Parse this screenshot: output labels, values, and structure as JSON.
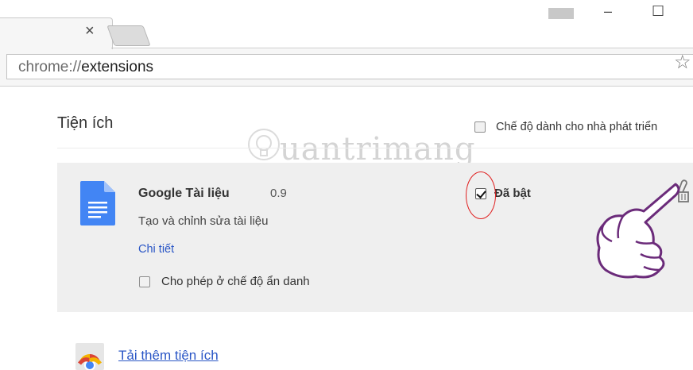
{
  "browser": {
    "tab_close_glyph": "×",
    "window_minimize_glyph": "–",
    "window_maximize_glyph": "☐",
    "url_scheme": "chrome://",
    "url_path": "extensions",
    "star_glyph": "☆"
  },
  "page": {
    "title": "Tiện ích",
    "developer_mode_label": "Chế độ dành cho nhà phát triển",
    "developer_mode_checked": false
  },
  "extension": {
    "name": "Google Tài liệu",
    "version": "0.9",
    "description": "Tạo và chỉnh sửa tài liệu",
    "details_link": "Chi tiết",
    "incognito_label": "Cho phép ở chế độ ẩn danh",
    "incognito_checked": false,
    "enabled_label": "Đã bật",
    "enabled_checked": true,
    "icon": "google-docs-icon"
  },
  "footer": {
    "get_more_link": "Tải thêm tiện ích"
  },
  "watermark": {
    "text": "uantrimang"
  },
  "colors": {
    "link": "#2a56c6",
    "docs_blue": "#4285f4",
    "highlight_circle": "#e02020",
    "hand_outline": "#6b2b7a"
  }
}
